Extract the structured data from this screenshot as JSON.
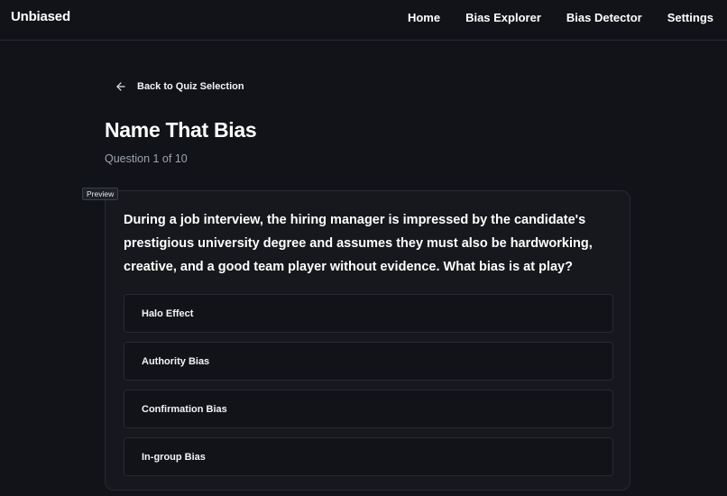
{
  "header": {
    "brand": "Unbiased",
    "nav": [
      "Home",
      "Bias Explorer",
      "Bias Detector",
      "Settings"
    ]
  },
  "page": {
    "back_label": "Back to Quiz Selection",
    "title": "Name That Bias",
    "progress": "Question 1 of 10",
    "preview_badge": "Preview"
  },
  "quiz": {
    "question": "During a job interview, the hiring manager is impressed by the candidate's prestigious university degree and assumes they must also be hardworking, creative, and a good team player without evidence. What bias is at play?",
    "options": [
      "Halo Effect",
      "Authority Bias",
      "Confirmation Bias",
      "In-group Bias"
    ]
  },
  "icons": {
    "back": "arrow-left-icon"
  }
}
